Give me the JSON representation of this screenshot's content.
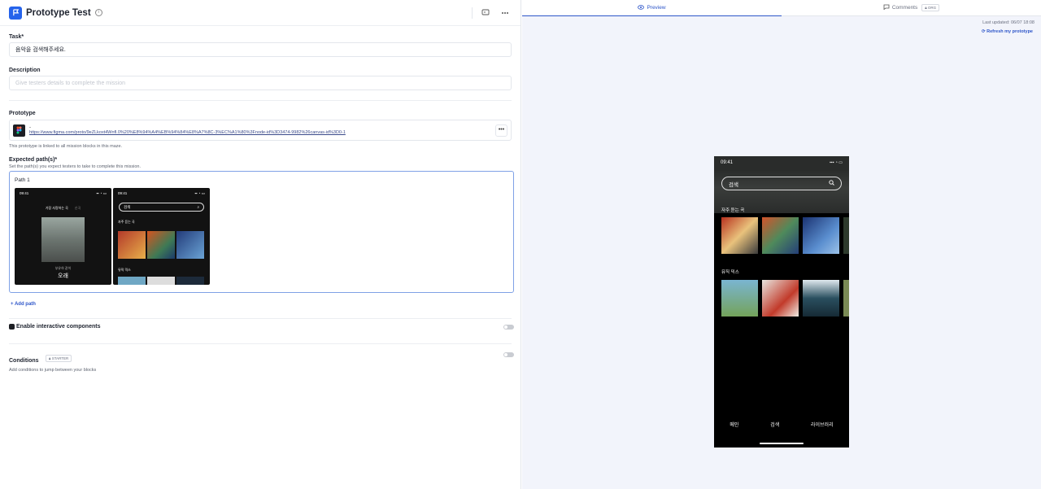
{
  "header": {
    "title": "Prototype Test",
    "info_icon": "info-icon",
    "monitor_icon": "monitor-icon",
    "more_icon": "more-horizontal-icon"
  },
  "task": {
    "label": "Task*",
    "value": "음악을 검색해주세요."
  },
  "description": {
    "label": "Description",
    "placeholder": "Give testers details to complete the mission"
  },
  "prototype": {
    "label": "Prototype",
    "name": "-",
    "url": "https://www.figma.com/proto/9eZLkoxt4Wnfl.0%20%E8%94%A4%EB%94%84%E8%A7%8C-3%EC%A1%80%3Fnode-id%3D3474-9982%26canvas-id%3D0-1",
    "more": "•••",
    "note": "This prototype is linked to all mission blocks in this maze."
  },
  "expected_paths": {
    "label": "Expected path(s)*",
    "help": "Set the path(s) you expect testers to take to complete this mission.",
    "paths": [
      {
        "label": "Path 1",
        "screens": [
          {
            "time": "09:41",
            "tab_a": "가장 사랑하는 곡",
            "tab_b": "신곡",
            "caption_small": "부유하 같이",
            "caption_big": "오래"
          },
          {
            "time": "09:41",
            "search": "검색",
            "section_a": "자주 듣는 곡",
            "section_b": "뮤직 믹스"
          }
        ]
      }
    ],
    "add_label": "+ Add path"
  },
  "interactive": {
    "label": "Enable interactive components",
    "enabled": false
  },
  "conditions": {
    "label": "Conditions",
    "badge": "STARTER",
    "help": "Add conditions to jump between your blocks",
    "enabled": false
  },
  "right": {
    "tabs": [
      {
        "label": "Preview",
        "icon": "eye-icon",
        "active": true
      },
      {
        "label": "Comments",
        "icon": "comment-icon",
        "badge": "ORG",
        "active": false
      }
    ],
    "last_updated": "Last updated: 06/07 18:08",
    "refresh": "Refresh my prototype",
    "phone": {
      "time": "09:41",
      "search": "검색",
      "section_a": "자주 듣는 곡",
      "section_b": "뮤직 믹스",
      "nav": [
        "메인",
        "검색",
        "라이브러리"
      ]
    }
  },
  "colors": {
    "accent": "#2e56c9",
    "brand": "#2563eb",
    "preview_bg": "#f2f4fb"
  }
}
